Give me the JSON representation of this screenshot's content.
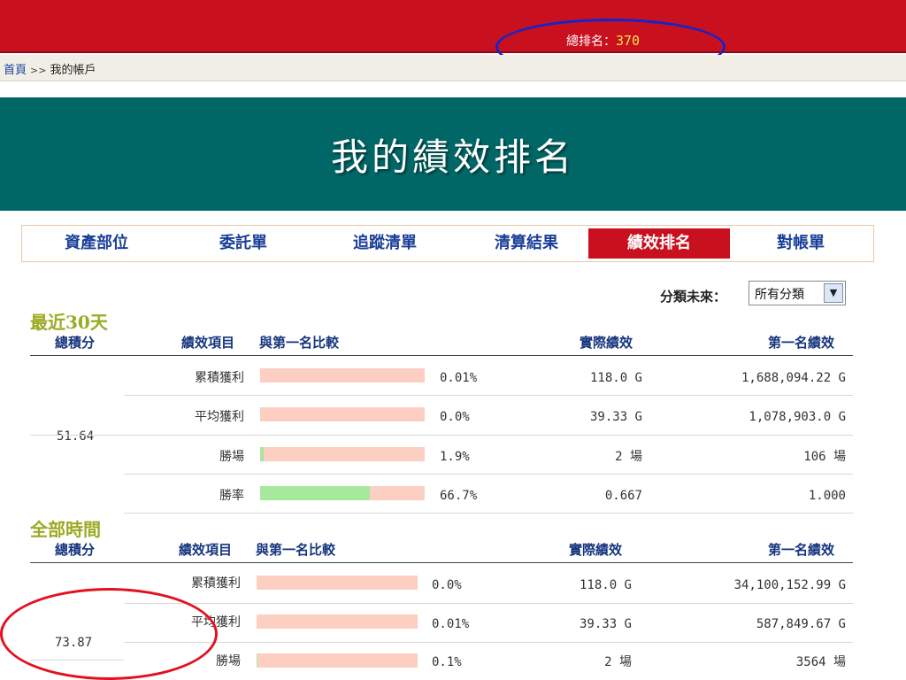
{
  "header": {
    "rank_label": "總排名：",
    "rank_value": "370"
  },
  "breadcrumb": {
    "home": "首頁",
    "separator": ">>",
    "current": "我的帳戶"
  },
  "page_title": "我的績效排名",
  "tabs": [
    "資產部位",
    "委託單",
    "追蹤清單",
    "清算結果",
    "績效排名",
    "對帳單"
  ],
  "active_tab": "績效排名",
  "filter": {
    "label": "分類未來：",
    "selected": "所有分類"
  },
  "columns": {
    "score": "總積分",
    "item": "績效項目",
    "compare": "與第一名比較",
    "actual": "實際績效",
    "first": "第一名績效"
  },
  "sections": [
    {
      "title": "最近30天",
      "score": "51.64",
      "rows": [
        {
          "item": "累積獲利",
          "pct": "0.01%",
          "fraction": 0.0001,
          "actual": "118.0 G",
          "first": "1,688,094.22 G"
        },
        {
          "item": "平均獲利",
          "pct": "0.0%",
          "fraction": 0.0,
          "actual": "39.33 G",
          "first": "1,078,903.0 G"
        },
        {
          "item": "勝場",
          "pct": "1.9%",
          "fraction": 0.019,
          "actual": "2 場",
          "first": "106 場"
        },
        {
          "item": "勝率",
          "pct": "66.7%",
          "fraction": 0.667,
          "actual": "0.667",
          "first": "1.000"
        }
      ]
    },
    {
      "title": "全部時間",
      "score": "73.87",
      "rows": [
        {
          "item": "累積獲利",
          "pct": "0.0%",
          "fraction": 0.0,
          "actual": "118.0 G",
          "first": "34,100,152.99 G"
        },
        {
          "item": "平均獲利",
          "pct": "0.01%",
          "fraction": 0.0001,
          "actual": "39.33 G",
          "first": "587,849.67 G"
        },
        {
          "item": "勝場",
          "pct": "0.1%",
          "fraction": 0.001,
          "actual": "2 場",
          "first": "3564 場"
        }
      ]
    }
  ],
  "colors": {
    "top_bar": "#c8101f",
    "title_band": "#006666",
    "tab_text": "#1b3f99",
    "section_title": "#9aaa22",
    "bar_bg": "#fccfc2",
    "bar_fill": "#a6e89c"
  }
}
